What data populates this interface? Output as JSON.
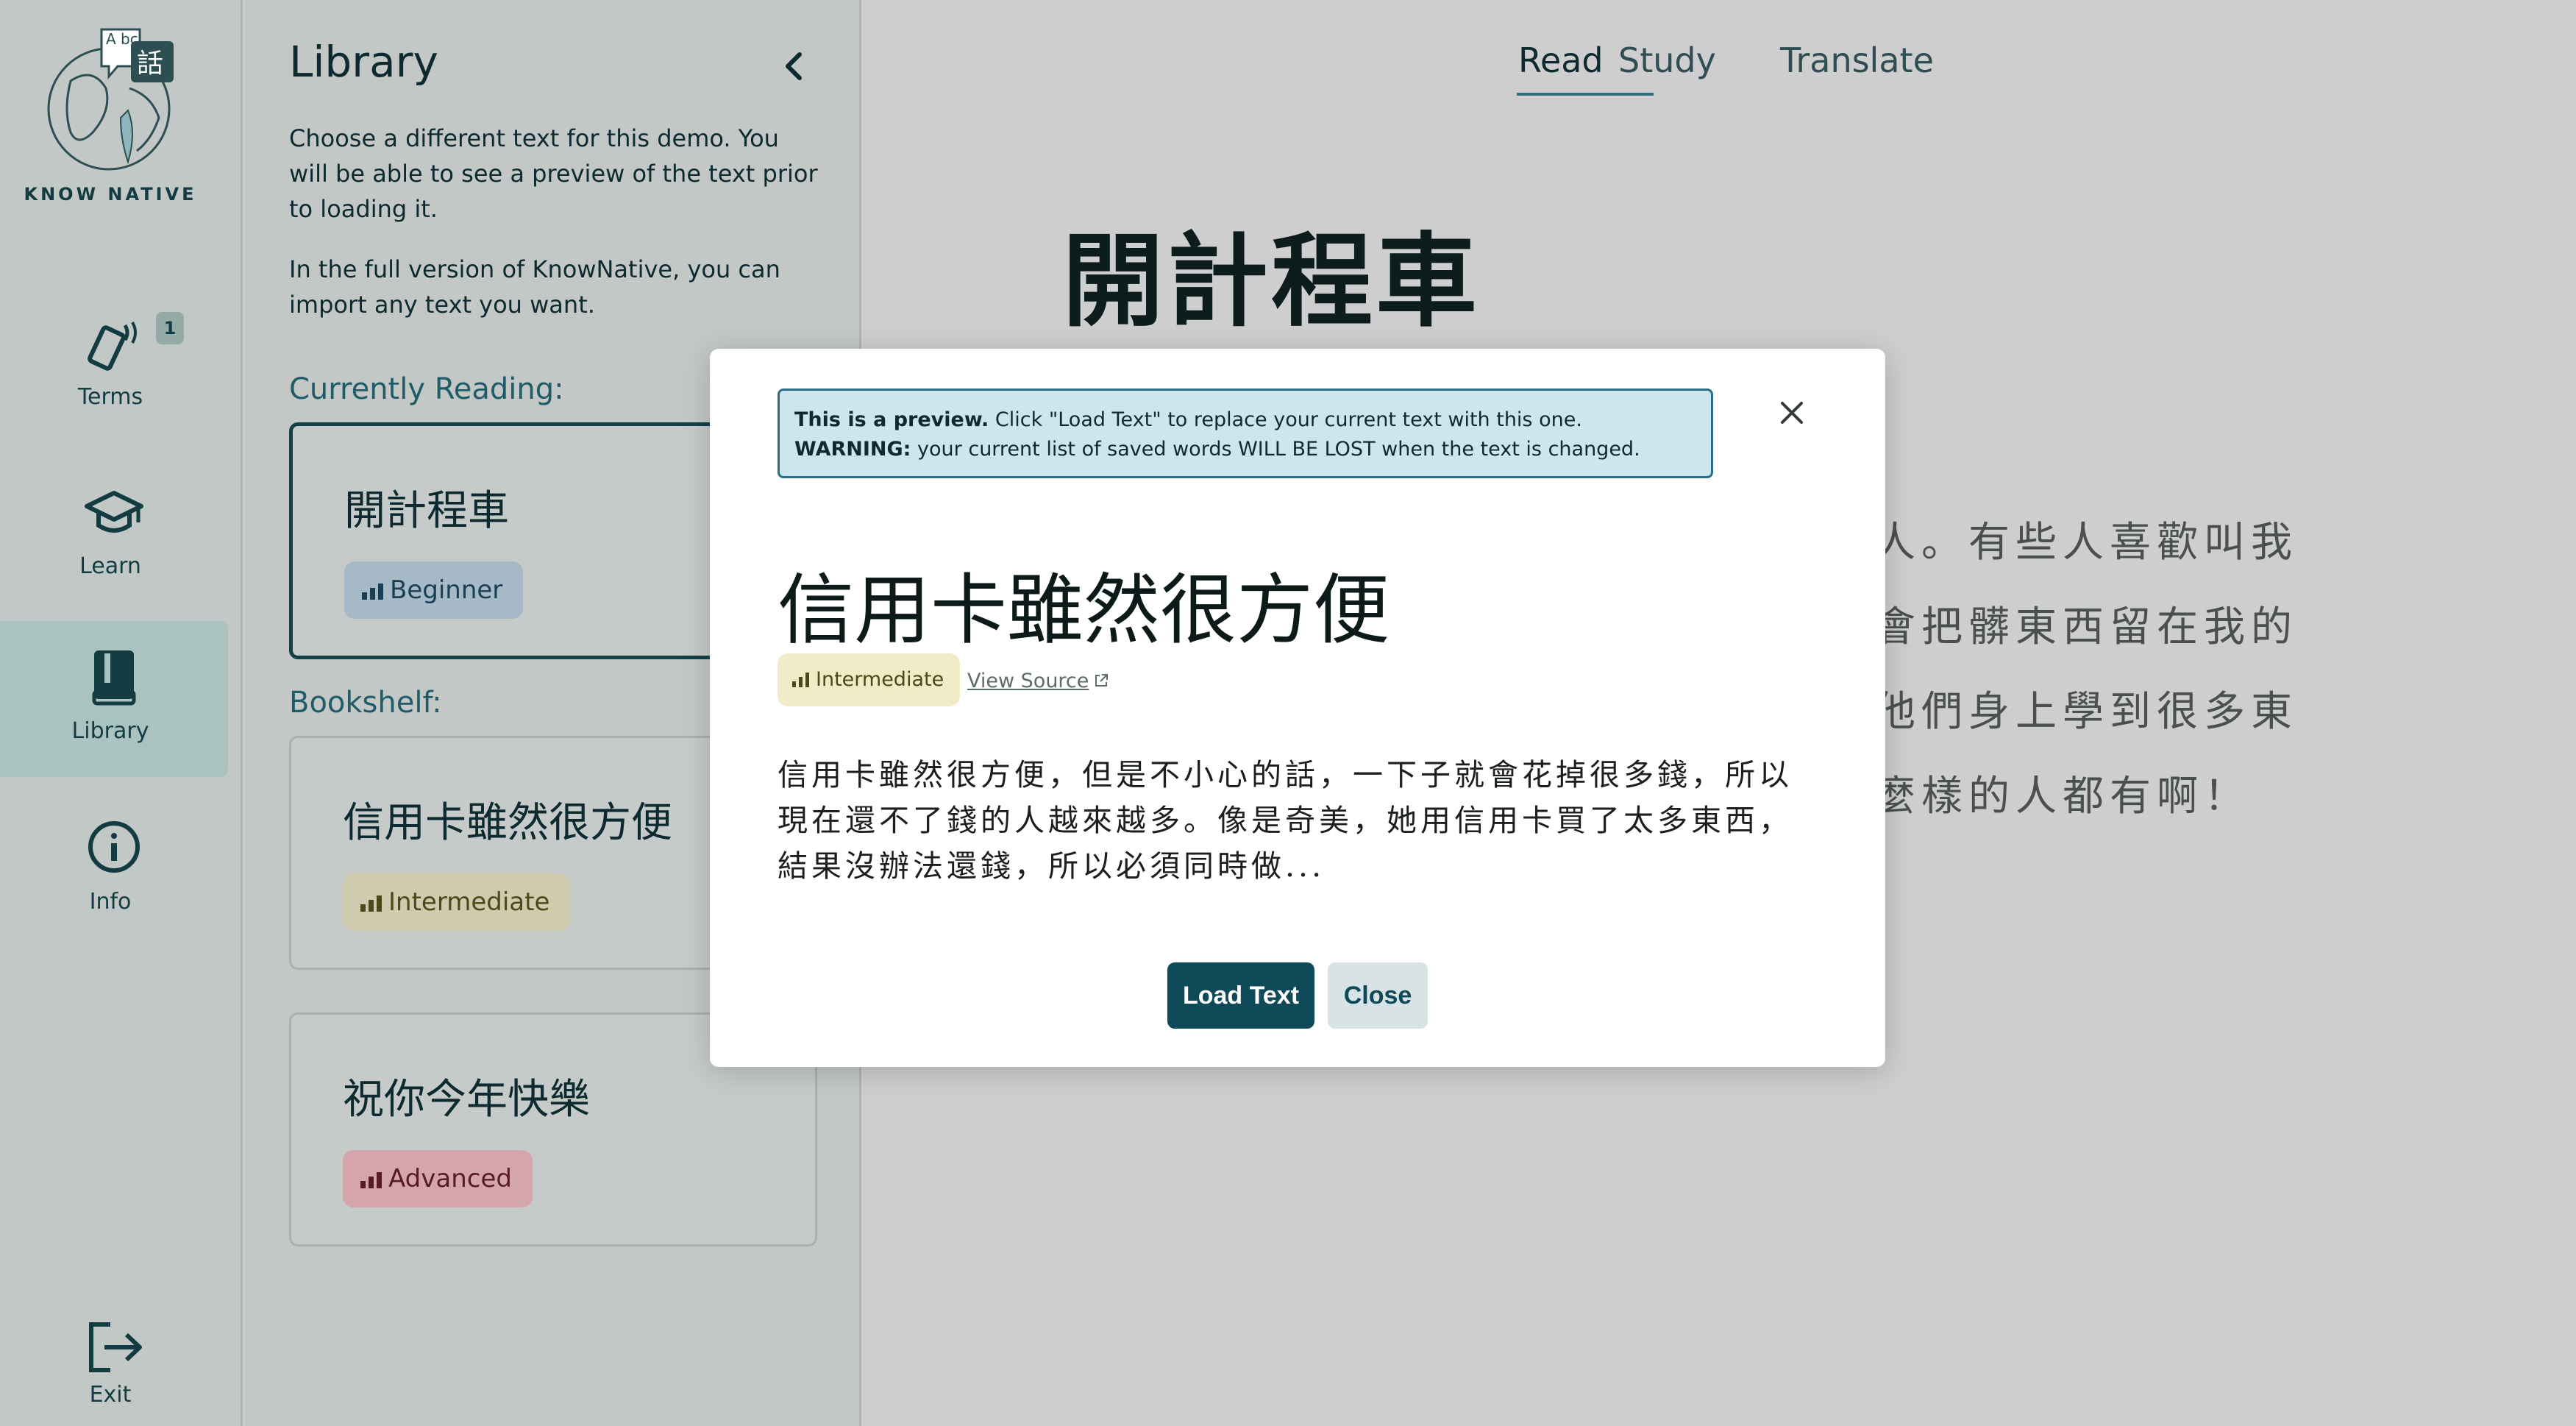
{
  "brand": {
    "name": "KNOW NATIVE",
    "logo_glyph": "話",
    "logo_letters": "A bc"
  },
  "nav": {
    "items": [
      {
        "key": "terms",
        "label": "Terms",
        "icon": "phone-swipe-icon",
        "badge": "1"
      },
      {
        "key": "learn",
        "label": "Learn",
        "icon": "graduation-cap-icon"
      },
      {
        "key": "library",
        "label": "Library",
        "icon": "book-icon",
        "active": true
      },
      {
        "key": "info",
        "label": "Info",
        "icon": "info-icon"
      },
      {
        "key": "exit",
        "label": "Exit",
        "icon": "exit-icon"
      }
    ]
  },
  "library": {
    "title": "Library",
    "desc1": "Choose a different text for this demo. You will be able to see a preview of the text prior to loading it.",
    "desc2": "In the full version of KnowNative, you can import any text you want.",
    "current_heading": "Currently Reading:",
    "current": {
      "title": "開計程車",
      "level": "Beginner"
    },
    "bookshelf_heading": "Bookshelf:",
    "books": [
      {
        "title": "信用卡雖然很方便",
        "level": "Intermediate"
      },
      {
        "title": "祝你今年快樂",
        "level": "Advanced"
      }
    ]
  },
  "reader": {
    "tabs": [
      "Read",
      "Study",
      "Translate"
    ],
    "active_tab": "Read",
    "title": "開計程車",
    "visible_lines": [
      "多人。有些人喜歡叫我",
      "人會把髒東西留在我的",
      "從他們身上學到很多東",
      "什麼樣的人都有啊！"
    ]
  },
  "modal": {
    "notice_bold1": "This is a preview.",
    "notice_text1": " Click \"Load Text\" to replace your current text with this one. ",
    "notice_bold2": "WARNING:",
    "notice_text2": " your current list of saved words WILL BE LOST when the text is changed.",
    "title": "信用卡雖然很方便",
    "level": "Intermediate",
    "view_source": "View Source",
    "preview_text": "信用卡雖然很方便，但是不小心的話，一下子就會花掉很多錢，所以現在還不了錢的人越來越多。像是奇美，她用信用卡買了太多東西，結果沒辦法還錢，所以必須同時做...",
    "load_button": "Load Text",
    "close_button": "Close"
  },
  "colors": {
    "primary": "#0f4a58",
    "beginner": "#a6b9c6",
    "intermediate": "#cfcbae",
    "advanced": "#d4a6ab",
    "notice_bg": "#cde6ee"
  }
}
